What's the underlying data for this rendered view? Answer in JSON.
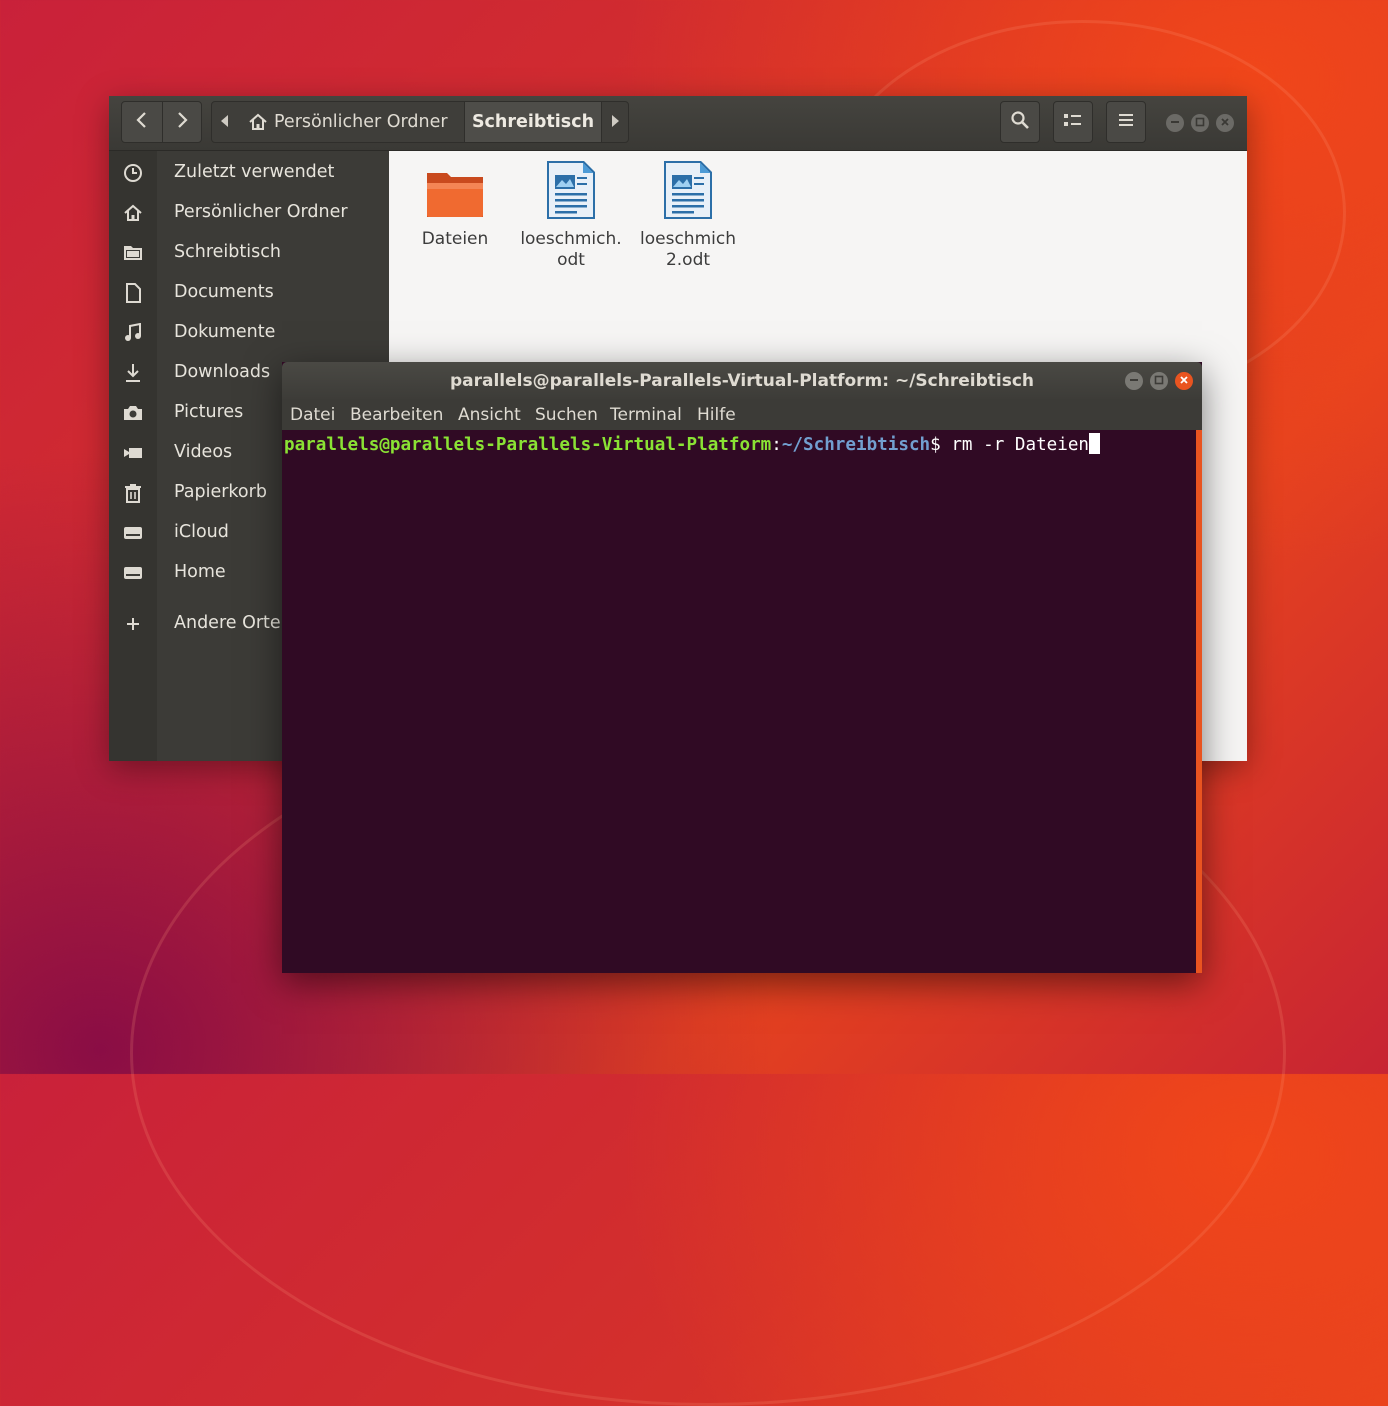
{
  "nautilus": {
    "pathbar": {
      "home_label": "Persönlicher Ordner",
      "current_label": "Schreibtisch"
    },
    "sidebar": {
      "items": [
        {
          "label": "Zuletzt verwendet",
          "icon": "clock-icon"
        },
        {
          "label": "Persönlicher Ordner",
          "icon": "home-icon"
        },
        {
          "label": "Schreibtisch",
          "icon": "folder-icon"
        },
        {
          "label": "Documents",
          "icon": "document-icon"
        },
        {
          "label": "Dokumente",
          "icon": "music-icon"
        },
        {
          "label": "Downloads",
          "icon": "download-icon"
        },
        {
          "label": "Pictures",
          "icon": "camera-icon"
        },
        {
          "label": "Videos",
          "icon": "video-icon"
        },
        {
          "label": "Papierkorb",
          "icon": "trash-icon"
        },
        {
          "label": "iCloud",
          "icon": "drive-icon"
        },
        {
          "label": "Home",
          "icon": "drive-icon"
        },
        {
          "label": "Andere Orte",
          "icon": "plus-icon"
        }
      ]
    },
    "files": [
      {
        "line1": "Dateien",
        "line2": "",
        "icon": "folder-icon"
      },
      {
        "line1": "loeschmich.",
        "line2": "odt",
        "icon": "odt-document-icon"
      },
      {
        "line1": "loeschmich",
        "line2": "2.odt",
        "icon": "odt-document-icon"
      }
    ]
  },
  "terminal": {
    "title": "parallels@parallels-Parallels-Virtual-Platform: ~/Schreibtisch",
    "menu": [
      "Datei",
      "Bearbeiten",
      "Ansicht",
      "Suchen",
      "Terminal",
      "Hilfe"
    ],
    "prompt_user": "parallels@parallels-Parallels-Virtual-Platform",
    "prompt_sep": ":",
    "prompt_path": "~/Schreibtisch",
    "prompt_symbol": "$ ",
    "command": "rm -r Dateien"
  },
  "colors": {
    "accent": "#e95420",
    "terminal_bg": "#300a24",
    "prompt_user": "#8ae234",
    "prompt_path": "#729fcf"
  }
}
